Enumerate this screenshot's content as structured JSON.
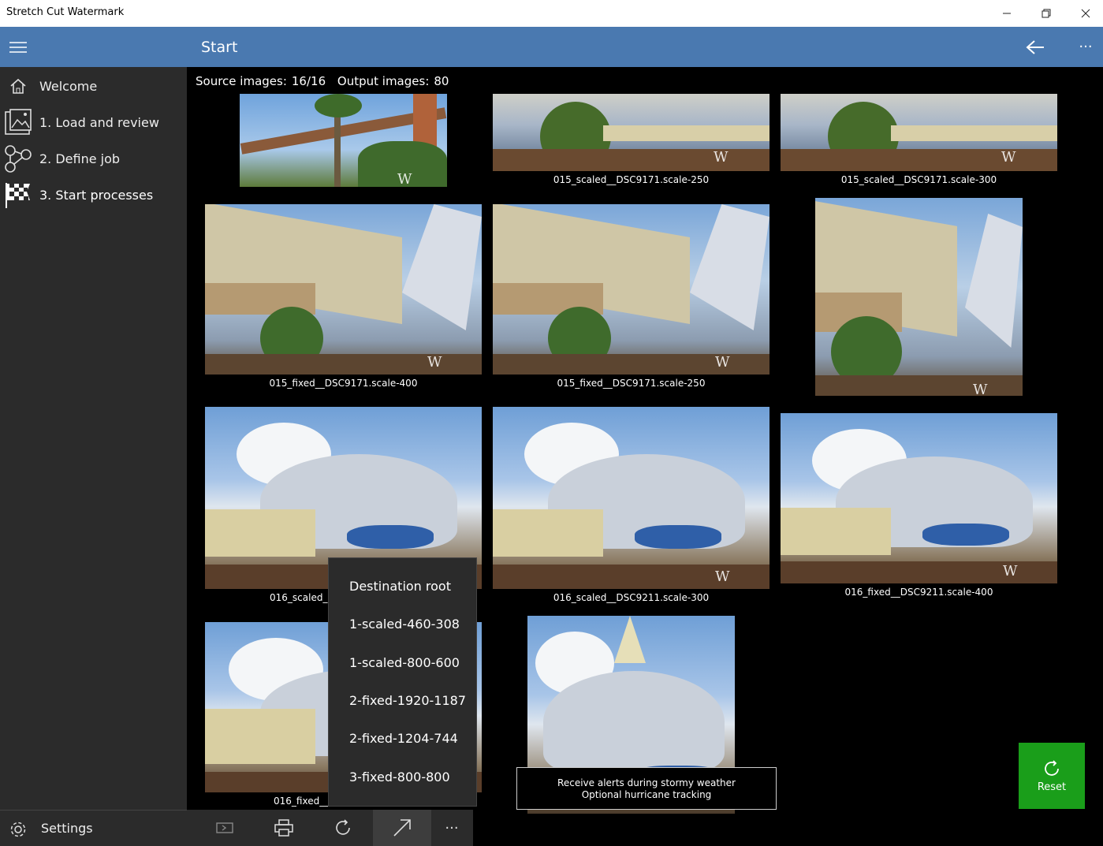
{
  "window": {
    "title": "Stretch Cut Watermark"
  },
  "header": {
    "title": "Start"
  },
  "sidebar": {
    "items": [
      {
        "label": "Welcome",
        "icon": "home-icon"
      },
      {
        "label": "1. Load and review",
        "icon": "images-icon"
      },
      {
        "label": "2. Define job",
        "icon": "nodes-icon"
      },
      {
        "label": "3. Start processes",
        "icon": "checkered-flag-icon"
      }
    ],
    "settings_label": "Settings"
  },
  "counts": {
    "source_label": "Source images:",
    "source_value": "16/16",
    "output_label": "Output images:",
    "output_value": "80"
  },
  "thumbnails": [
    {
      "caption": ""
    },
    {
      "caption": "015_scaled__DSC9171.scale-250"
    },
    {
      "caption": "015_scaled__DSC9171.scale-300"
    },
    {
      "caption": "015_fixed__DSC9171.scale-400"
    },
    {
      "caption": "015_fixed__DSC9171.scale-250"
    },
    {
      "caption": ""
    },
    {
      "caption": "016_scaled_"
    },
    {
      "caption": "016_scaled__DSC9211.scale-300"
    },
    {
      "caption": "016_fixed__DSC9211.scale-400"
    },
    {
      "caption": "016_fixed__"
    },
    {
      "caption": ""
    }
  ],
  "watermark_text": "W",
  "context_menu": {
    "items": [
      "Destination root",
      "1-scaled-460-308",
      "1-scaled-800-600",
      "2-fixed-1920-1187",
      "2-fixed-1204-744",
      "3-fixed-800-800"
    ]
  },
  "tooltip": {
    "line1": "Receive alerts during stormy weather",
    "line2": "Optional hurricane tracking"
  },
  "reset": {
    "label": "Reset"
  },
  "colors": {
    "header": "#4a79b0",
    "sidebar": "#2b2b2b",
    "reset": "#1a9e1a"
  }
}
